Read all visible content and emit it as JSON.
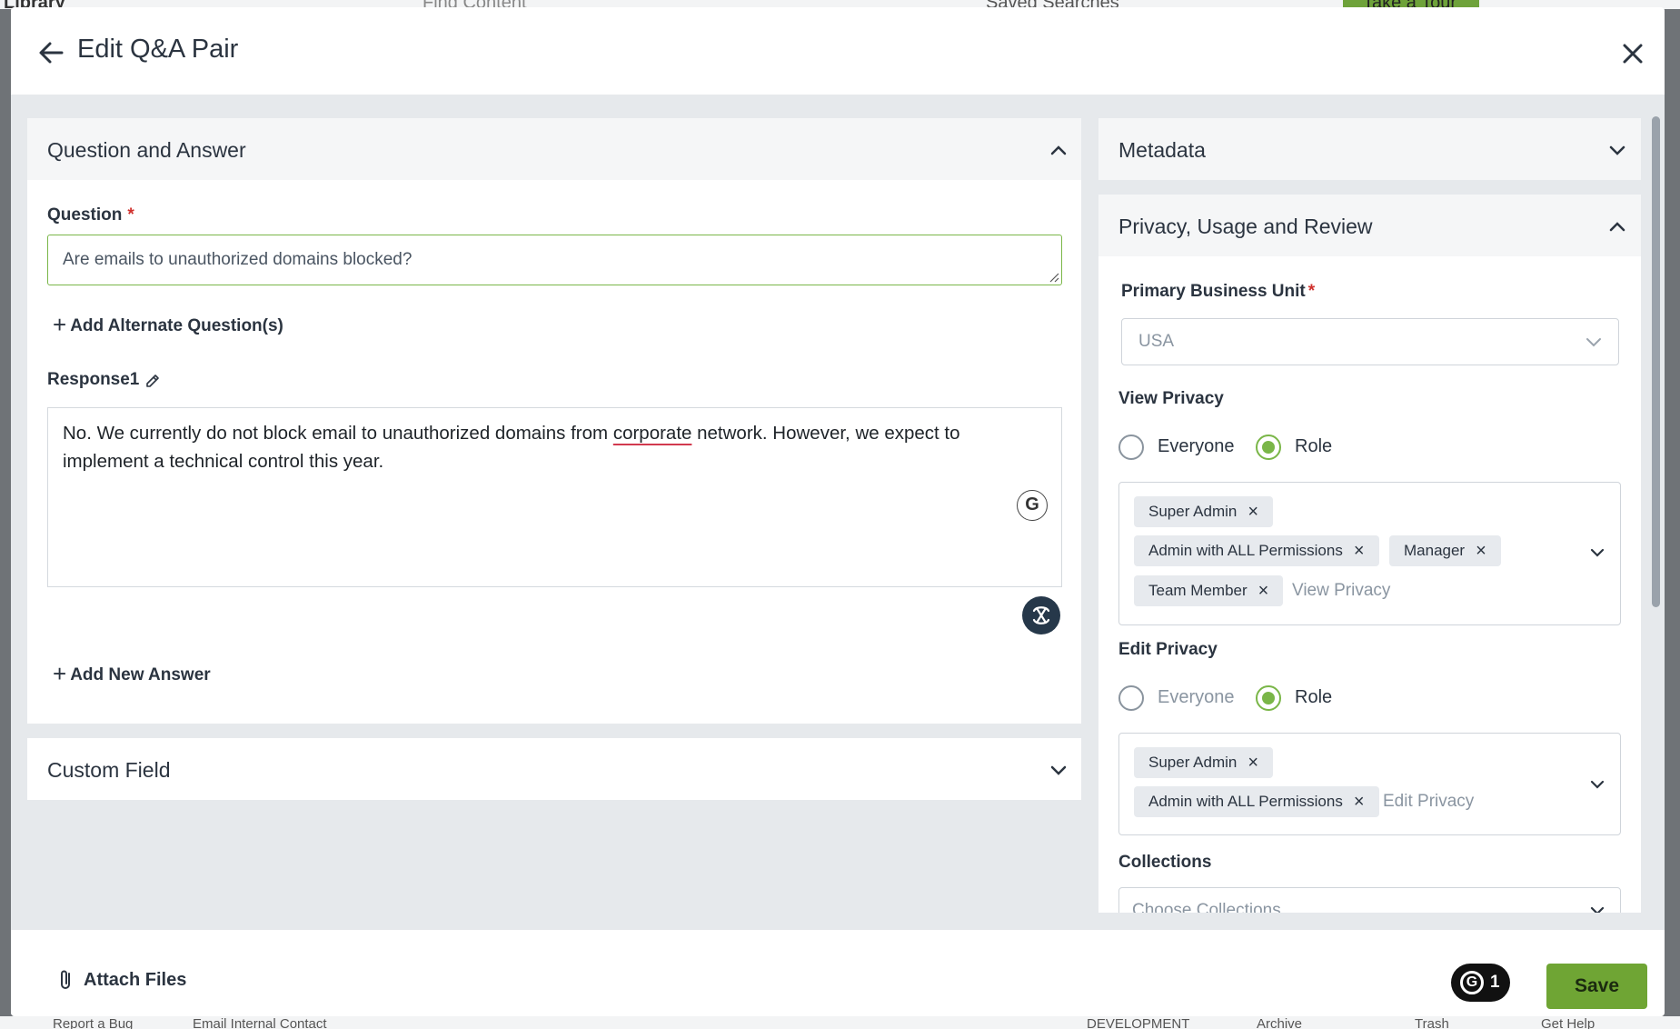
{
  "background": {
    "library_label": "Library",
    "find_placeholder": "Find Content",
    "saved_searches": "Saved Searches",
    "take_tour": "Take a Tour",
    "report_bug": "Report a Bug",
    "email_contact": "Email Internal Contact",
    "environment": "DEVELOPMENT",
    "archive": "Archive",
    "trash": "Trash",
    "get_help": "Get Help"
  },
  "modal": {
    "title": "Edit Q&A Pair"
  },
  "qa_section": {
    "title": "Question and Answer",
    "question_label": "Question",
    "required_mark": "*",
    "question_value": "Are emails to unauthorized domains blocked?",
    "add_alternate": "Add Alternate Question(s)",
    "response_label": "Response1",
    "response_text_before": "No. We currently do not block email to unauthorized domains from ",
    "response_text_flagged": "corporate",
    "response_text_after": " network. However, we expect to implement a technical control this year.",
    "grammarly_letter": "G",
    "add_answer": "Add New Answer"
  },
  "custom_field": {
    "title": "Custom Field"
  },
  "metadata": {
    "title": "Metadata"
  },
  "privacy": {
    "title": "Privacy, Usage and Review",
    "business_unit_label": "Primary Business Unit",
    "required_mark": "*",
    "business_unit_value": "USA",
    "view_privacy_label": "View Privacy",
    "view_options": [
      "Everyone",
      "Role"
    ],
    "view_selected": "Role",
    "view_tags": [
      "Super Admin",
      "Admin with ALL Permissions",
      "Manager",
      "Team Member"
    ],
    "view_placeholder": "View Privacy",
    "edit_privacy_label": "Edit Privacy",
    "edit_options": [
      "Everyone",
      "Role"
    ],
    "edit_selected": "Role",
    "edit_tags": [
      "Super Admin",
      "Admin with ALL Permissions"
    ],
    "edit_placeholder": "Edit Privacy",
    "collections_label": "Collections",
    "collections_placeholder": "Choose Collections"
  },
  "footer": {
    "attach_files": "Attach Files",
    "grammarly_count": "1",
    "save": "Save"
  },
  "colors": {
    "accent_green": "#7ab648",
    "save_green": "#6fa534",
    "required_red": "#d0312d"
  }
}
